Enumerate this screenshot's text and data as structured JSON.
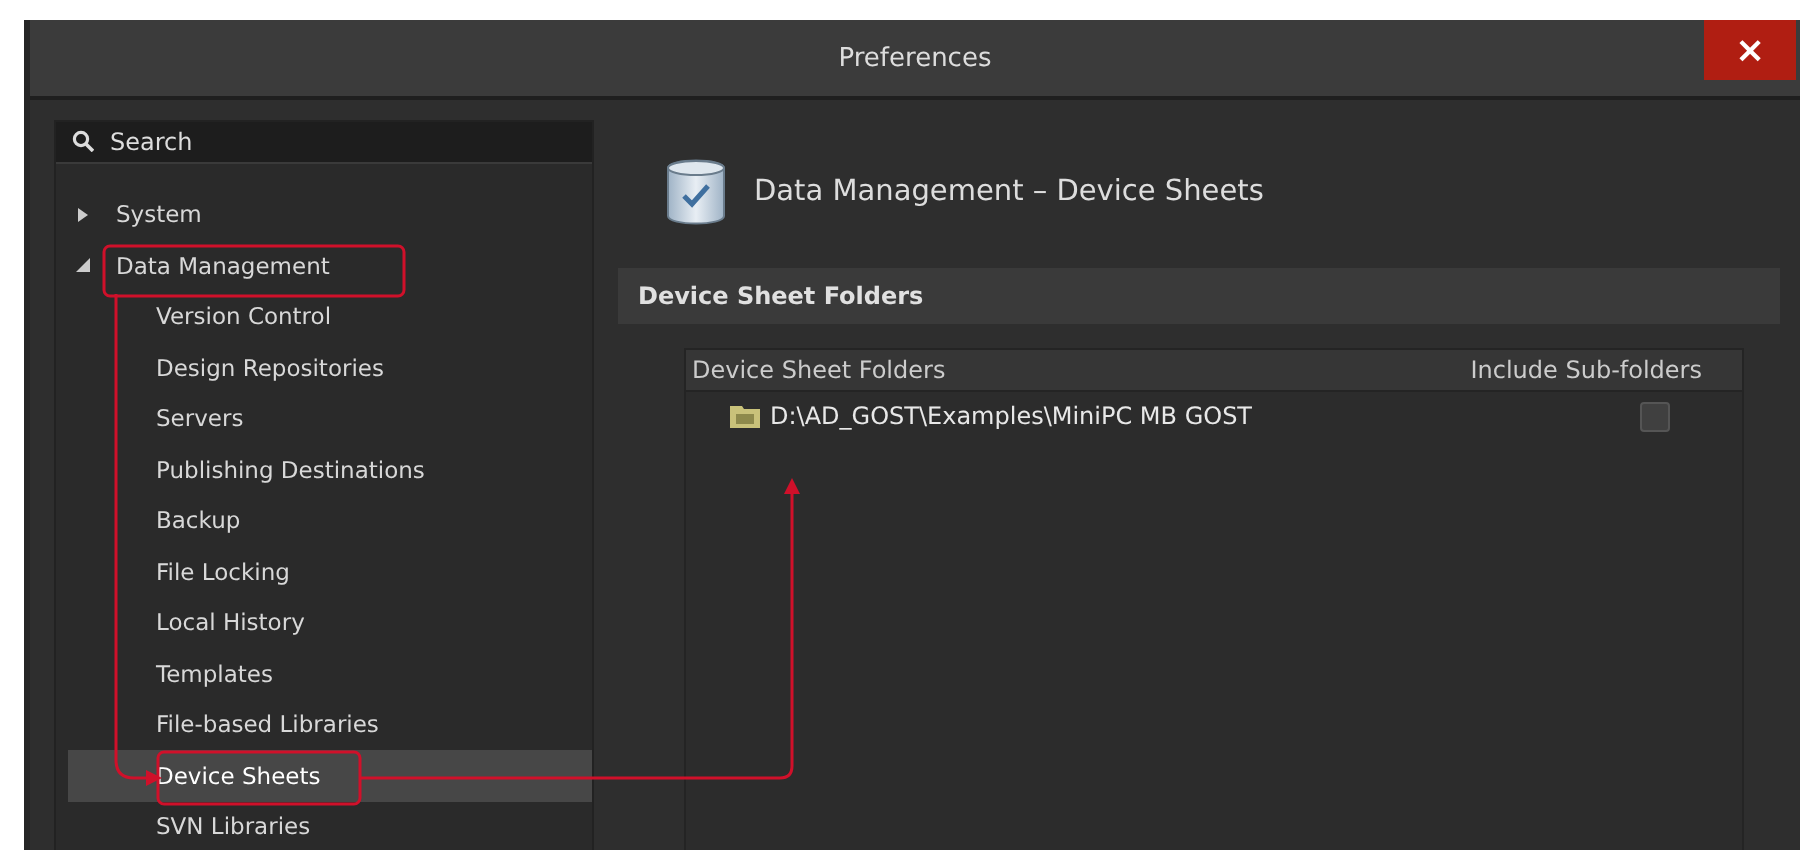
{
  "window": {
    "title": "Preferences",
    "close": "×"
  },
  "search": {
    "placeholder": "Search"
  },
  "tree": [
    {
      "label": "System",
      "expanded": false,
      "selected": false
    },
    {
      "label": "Data Management",
      "expanded": true,
      "selected": false,
      "children": [
        {
          "label": "Version Control",
          "selected": false
        },
        {
          "label": "Design Repositories",
          "selected": false
        },
        {
          "label": "Servers",
          "selected": false
        },
        {
          "label": "Publishing Destinations",
          "selected": false
        },
        {
          "label": "Backup",
          "selected": false
        },
        {
          "label": "File Locking",
          "selected": false
        },
        {
          "label": "Local History",
          "selected": false
        },
        {
          "label": "Templates",
          "selected": false
        },
        {
          "label": "File-based Libraries",
          "selected": false
        },
        {
          "label": "Device Sheets",
          "selected": true
        },
        {
          "label": "SVN Libraries",
          "selected": false
        }
      ]
    }
  ],
  "page": {
    "title": "Data Management – Device Sheets",
    "section": "Device Sheet Folders"
  },
  "table": {
    "columns": [
      "Device Sheet Folders",
      "Include Sub-folders"
    ],
    "rows": [
      {
        "path": "D:\\AD_GOST\\Examples\\MiniPC MB GOST",
        "include_subfolders": false
      }
    ]
  }
}
